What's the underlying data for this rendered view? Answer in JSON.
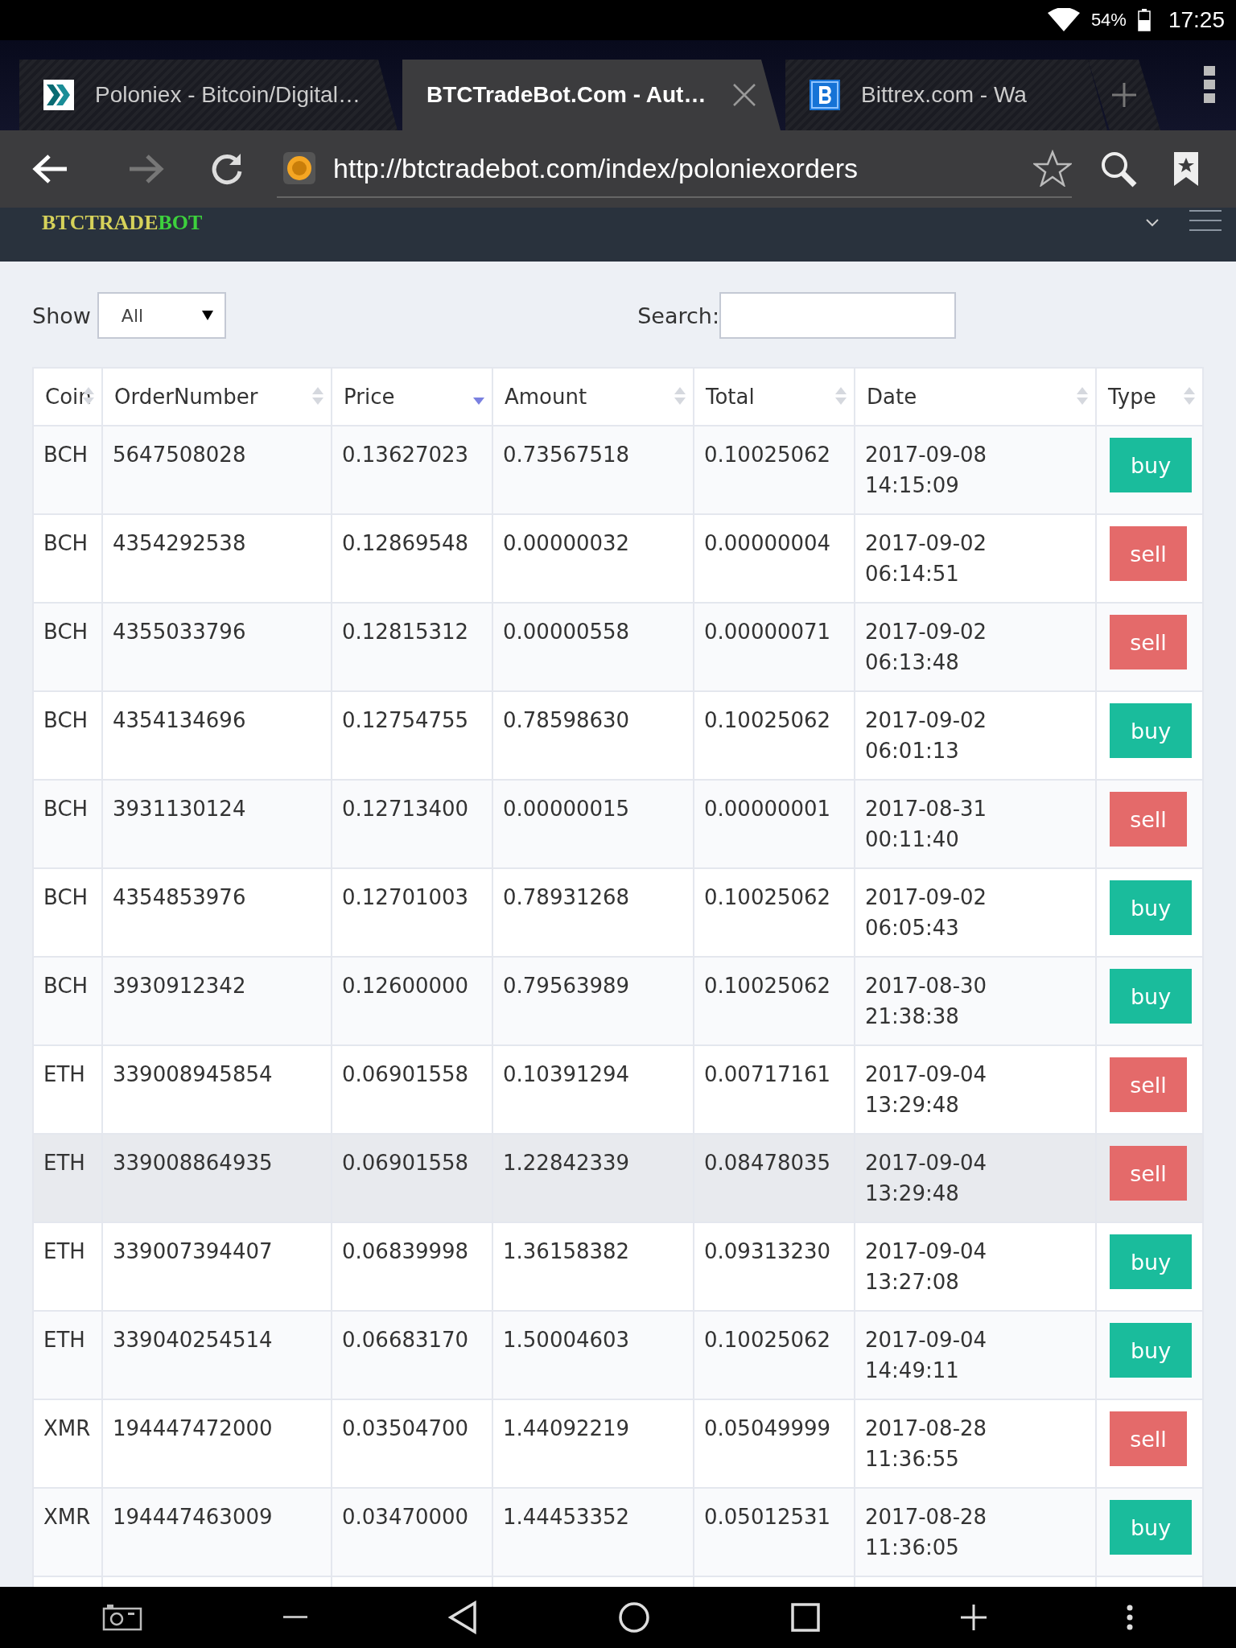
{
  "status_bar": {
    "battery": "54%",
    "time": "17:25"
  },
  "tabs": [
    {
      "title": "Poloniex - Bitcoin/Digital…",
      "selected": false
    },
    {
      "title": "BTCTradeBot.Com - Aut…",
      "selected": true
    },
    {
      "title": "Bittrex.com - Wa",
      "selected": false
    }
  ],
  "address_bar": {
    "url": "http://btctradebot.com/index/poloniexorders"
  },
  "site_header": {
    "logo_part1": "BTCTRADE",
    "logo_part2": "BOT"
  },
  "controls": {
    "show_label": "Show",
    "show_value": "All",
    "search_label": "Search:"
  },
  "table": {
    "columns": [
      {
        "label": "Coin",
        "sorted": false
      },
      {
        "label": "OrderNumber",
        "sorted": false
      },
      {
        "label": "Price",
        "sorted": true
      },
      {
        "label": "Amount",
        "sorted": false
      },
      {
        "label": "Total",
        "sorted": false
      },
      {
        "label": "Date",
        "sorted": false
      },
      {
        "label": "Type",
        "sorted": false
      }
    ],
    "rows": [
      {
        "coin": "BCH",
        "order": "5647508028",
        "price": "0.13627023",
        "amount": "0.73567518",
        "total": "0.10025062",
        "date": "2017-09-08",
        "time": "14:15:09",
        "type": "buy",
        "kind": "buy",
        "hovered": false
      },
      {
        "coin": "BCH",
        "order": "4354292538",
        "price": "0.12869548",
        "amount": "0.00000032",
        "total": "0.00000004",
        "date": "2017-09-02",
        "time": "06:14:51",
        "type": "sell",
        "kind": "sell",
        "hovered": false
      },
      {
        "coin": "BCH",
        "order": "4355033796",
        "price": "0.12815312",
        "amount": "0.00000558",
        "total": "0.00000071",
        "date": "2017-09-02",
        "time": "06:13:48",
        "type": "sell",
        "kind": "sell",
        "hovered": false
      },
      {
        "coin": "BCH",
        "order": "4354134696",
        "price": "0.12754755",
        "amount": "0.78598630",
        "total": "0.10025062",
        "date": "2017-09-02",
        "time": "06:01:13",
        "type": "buy",
        "kind": "buy",
        "hovered": false
      },
      {
        "coin": "BCH",
        "order": "3931130124",
        "price": "0.12713400",
        "amount": "0.00000015",
        "total": "0.00000001",
        "date": "2017-08-31",
        "time": "00:11:40",
        "type": "sell",
        "kind": "sell",
        "hovered": false
      },
      {
        "coin": "BCH",
        "order": "4354853976",
        "price": "0.12701003",
        "amount": "0.78931268",
        "total": "0.10025062",
        "date": "2017-09-02",
        "time": "06:05:43",
        "type": "buy",
        "kind": "buy",
        "hovered": false
      },
      {
        "coin": "BCH",
        "order": "3930912342",
        "price": "0.12600000",
        "amount": "0.79563989",
        "total": "0.10025062",
        "date": "2017-08-30",
        "time": "21:38:38",
        "type": "buy",
        "kind": "buy",
        "hovered": false
      },
      {
        "coin": "ETH",
        "order": "339008945854",
        "price": "0.06901558",
        "amount": "0.10391294",
        "total": "0.00717161",
        "date": "2017-09-04",
        "time": "13:29:48",
        "type": "sell",
        "kind": "sell",
        "hovered": false
      },
      {
        "coin": "ETH",
        "order": "339008864935",
        "price": "0.06901558",
        "amount": "1.22842339",
        "total": "0.08478035",
        "date": "2017-09-04",
        "time": "13:29:48",
        "type": "sell",
        "kind": "sell",
        "hovered": true
      },
      {
        "coin": "ETH",
        "order": "339007394407",
        "price": "0.06839998",
        "amount": "1.36158382",
        "total": "0.09313230",
        "date": "2017-09-04",
        "time": "13:27:08",
        "type": "buy",
        "kind": "buy",
        "hovered": false
      },
      {
        "coin": "ETH",
        "order": "339040254514",
        "price": "0.06683170",
        "amount": "1.50004603",
        "total": "0.10025062",
        "date": "2017-09-04",
        "time": "14:49:11",
        "type": "buy",
        "kind": "buy",
        "hovered": false
      },
      {
        "coin": "XMR",
        "order": "194447472000",
        "price": "0.03504700",
        "amount": "1.44092219",
        "total": "0.05049999",
        "date": "2017-08-28",
        "time": "11:36:55",
        "type": "sell",
        "kind": "sell",
        "hovered": false
      },
      {
        "coin": "XMR",
        "order": "194447463009",
        "price": "0.03470000",
        "amount": "1.44453352",
        "total": "0.05012531",
        "date": "2017-08-28",
        "time": "11:36:05",
        "type": "buy",
        "kind": "buy",
        "hovered": false
      }
    ]
  }
}
